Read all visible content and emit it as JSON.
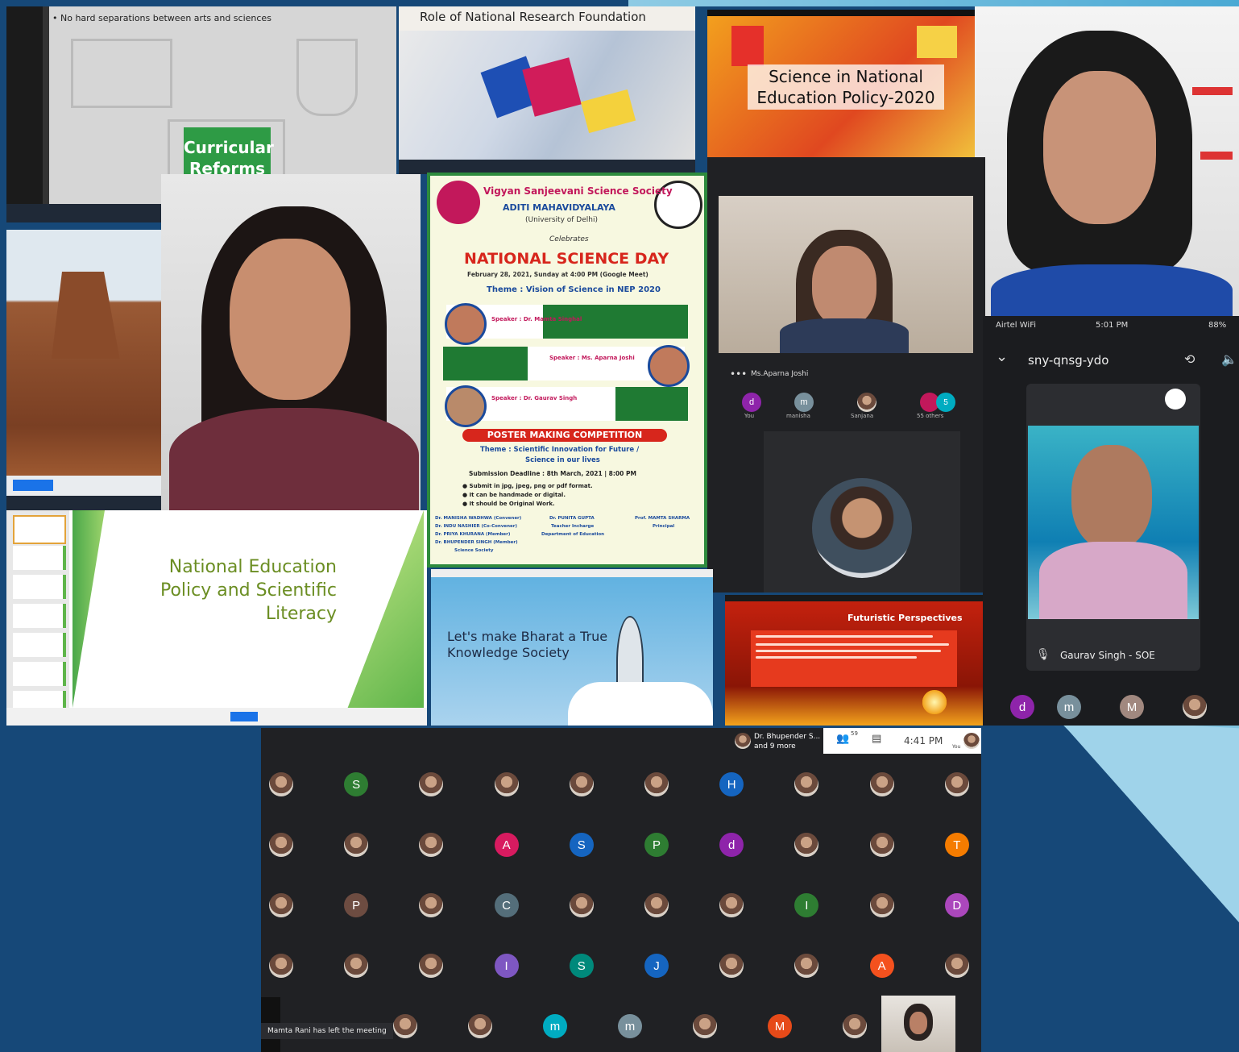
{
  "slides": {
    "arts_sciences_bullet": "• No hard separations between arts and sciences",
    "curricular_reforms": "Curricular Reforms",
    "nrf_title": "Role of National Research Foundation",
    "science_nep_title": "Science in National Education Policy-2020",
    "nep_literacy_title": "National Education Policy and Scientific Literacy",
    "bharat_title": "Let's make Bharat a True Knowledge Society",
    "futuristic_title": "Futuristic Perspectives"
  },
  "poster": {
    "society": "Vigyan Sanjeevani Science Society",
    "college": "ADITI MAHAVIDYALAYA",
    "university": "(University of Delhi)",
    "celebrates": "Celebrates",
    "event": "NATIONAL SCIENCE DAY",
    "date": "February 28, 2021, Sunday at 4:00 PM (Google Meet)",
    "theme": "Theme : Vision of Science in NEP 2020",
    "speaker1": "Speaker : Dr. Mamta Singhal",
    "speaker2": "Speaker : Ms. Aparna Joshi",
    "speaker3": "Speaker : Dr. Gaurav Singh",
    "competition": "POSTER MAKING COMPETITION",
    "comp_theme_1": "Theme : Scientific Innovation for Future /",
    "comp_theme_2": "Science in our lives",
    "deadline": "Submission Deadline : 8th March, 2021 | 8:00 PM",
    "rule1": "● Submit in jpg, jpeg, png or pdf format.",
    "rule2": "● It can be handmade or digital.",
    "rule3": "● It should be Original Work.",
    "convener_1": "Dr. MANISHA WADHWA (Convener)",
    "convener_2": "Dr. INDU NASHIER (Co-Convener)",
    "convener_3": "Dr. PRIYA KHURANA (Member)",
    "convener_4": "Dr. BHUPENDER SINGH (Member)",
    "convener_5": "Science Society",
    "teacher_1": "Dr. PUNITA GUPTA",
    "teacher_2": "Teacher Incharge",
    "teacher_3": "Department of Education",
    "principal_1": "Prof. MAMTA SHARMA",
    "principal_2": "Principal"
  },
  "meet_center": {
    "participant_name": "Ms.Aparna Joshi",
    "tiles": [
      "You",
      "manisha",
      "Sanjana",
      "55 others"
    ]
  },
  "phone": {
    "carrier": "Airtel WiFi",
    "time": "5:01 PM",
    "battery": "88%",
    "meeting_code": "sny-qnsg-ydo",
    "participant_name": "Gaurav Singh - SOE"
  },
  "meet_bottom": {
    "presenter": "Dr. Bhupender S...",
    "presenter_more": "and 9 more",
    "participants_count": "59",
    "time": "4:41 PM",
    "you_label": "You",
    "notification": "Mamta Rani has left the meeting",
    "rows": [
      [
        {
          "t": "photo"
        },
        {
          "t": "S",
          "c": "#2e7d32"
        },
        {
          "t": "photo"
        },
        {
          "t": "photo"
        },
        {
          "t": "photo"
        },
        {
          "t": "photo"
        },
        {
          "t": "H",
          "c": "#1565c0"
        },
        {
          "t": "photo"
        },
        {
          "t": "photo"
        },
        {
          "t": "photo"
        }
      ],
      [
        {
          "t": "photo"
        },
        {
          "t": "photo"
        },
        {
          "t": "photo"
        },
        {
          "t": "A",
          "c": "#d81b60"
        },
        {
          "t": "S",
          "c": "#1565c0"
        },
        {
          "t": "P",
          "c": "#2e7d32"
        },
        {
          "t": "d",
          "c": "#8e24aa"
        },
        {
          "t": "photo"
        },
        {
          "t": "photo"
        },
        {
          "t": "T",
          "c": "#f57c00"
        }
      ],
      [
        {
          "t": "photo"
        },
        {
          "t": "P",
          "c": "#6d4c41"
        },
        {
          "t": "photo"
        },
        {
          "t": "C",
          "c": "#546e7a"
        },
        {
          "t": "photo"
        },
        {
          "t": "photo"
        },
        {
          "t": "photo"
        },
        {
          "t": "I",
          "c": "#2e7d32"
        },
        {
          "t": "photo"
        },
        {
          "t": "D",
          "c": "#ab47bc"
        }
      ],
      [
        {
          "t": "photo"
        },
        {
          "t": "photo"
        },
        {
          "t": "photo"
        },
        {
          "t": "I",
          "c": "#7e57c2"
        },
        {
          "t": "S",
          "c": "#00897b"
        },
        {
          "t": "J",
          "c": "#1565c0"
        },
        {
          "t": "photo"
        },
        {
          "t": "photo"
        },
        {
          "t": "A",
          "c": "#f4511e"
        },
        {
          "t": "photo"
        }
      ],
      [
        {
          "t": "photo"
        },
        {
          "t": "photo"
        },
        {
          "t": "m",
          "c": "#00acc1"
        },
        {
          "t": "m",
          "c": "#78909c"
        },
        {
          "t": "photo"
        },
        {
          "t": "M",
          "c": "#e64a19"
        },
        {
          "t": "photo"
        }
      ]
    ]
  },
  "colors": {
    "background": "#164878",
    "accent_light": "#7fc3e0",
    "meet_dark": "#202124",
    "poster_red": "#d7261c"
  }
}
